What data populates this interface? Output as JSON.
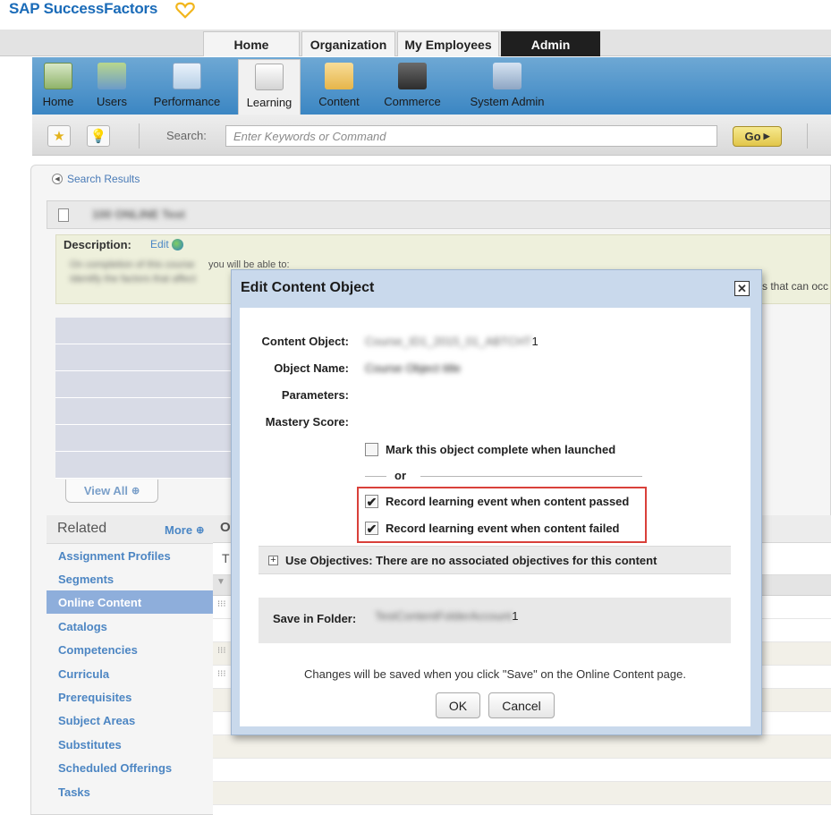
{
  "brand": {
    "name": "SAP SuccessFactors",
    "heart_color": "#f2b61d"
  },
  "top_tabs": [
    {
      "label": "Home",
      "active": false
    },
    {
      "label": "Organization",
      "active": false
    },
    {
      "label": "My Employees",
      "active": false
    },
    {
      "label": "Admin",
      "active": true
    }
  ],
  "modules": [
    {
      "label": "Home",
      "icon": "home-icon"
    },
    {
      "label": "Users",
      "icon": "users-icon"
    },
    {
      "label": "Performance",
      "icon": "performance-icon"
    },
    {
      "label": "Learning",
      "icon": "learning-icon",
      "active": true
    },
    {
      "label": "Content",
      "icon": "folder-icon"
    },
    {
      "label": "Commerce",
      "icon": "briefcase-icon"
    },
    {
      "label": "System Admin",
      "icon": "system-admin-icon"
    }
  ],
  "search": {
    "label": "Search:",
    "placeholder": "Enter Keywords or Command",
    "go_label": "Go"
  },
  "breadcrumb": {
    "back_label": "Search Results"
  },
  "item": {
    "title_blurred": "100 ONLINE Test",
    "description_label": "Description:",
    "edit_label": "Edit",
    "desc_line1_blurred": "On completion of this course",
    "desc_line1_visible": "you will be able to:",
    "desc_line2_blurred": "Identify the factors that affect",
    "desc_line2_tail": "s that can occ"
  },
  "view_all_label": "View All",
  "related": {
    "title": "Related",
    "more_label": "More",
    "items": [
      {
        "label": "Assignment Profiles",
        "active": false
      },
      {
        "label": "Segments",
        "active": false
      },
      {
        "label": "Online Content",
        "active": true
      },
      {
        "label": "Catalogs",
        "active": false
      },
      {
        "label": "Competencies",
        "active": false
      },
      {
        "label": "Curricula",
        "active": false
      },
      {
        "label": "Prerequisites",
        "active": false
      },
      {
        "label": "Subject Areas",
        "active": false
      },
      {
        "label": "Substitutes",
        "active": false
      },
      {
        "label": "Scheduled Offerings",
        "active": false
      },
      {
        "label": "Tasks",
        "active": false
      }
    ]
  },
  "right_table": {
    "header_initial": "O",
    "subheader_initial": "T"
  },
  "dialog": {
    "title": "Edit Content Object",
    "fields": {
      "content_object_label": "Content Object:",
      "content_object_blurred": "Course_ID1_2015_01_ABTCHT",
      "content_object_suffix": "1",
      "object_name_label": "Object Name:",
      "object_name_blurred": "Course Object title",
      "parameters_label": "Parameters:",
      "mastery_score_label": "Mastery Score:"
    },
    "mark_complete_label": "Mark this object complete when launched",
    "mark_complete_checked": false,
    "or_label": "or",
    "record_passed_label": "Record learning event when content passed",
    "record_passed_checked": true,
    "record_failed_label": "Record learning event when content failed",
    "record_failed_checked": true,
    "objectives_text": "Use Objectives: There are no associated objectives for this content",
    "save_folder_label": "Save in Folder:",
    "save_folder_blurred": "TestContentFolderAccount",
    "save_folder_suffix": "1",
    "note": "Changes will be saved when you click \"Save\" on the Online Content page.",
    "ok_label": "OK",
    "cancel_label": "Cancel",
    "highlight_color": "#d9403a"
  }
}
